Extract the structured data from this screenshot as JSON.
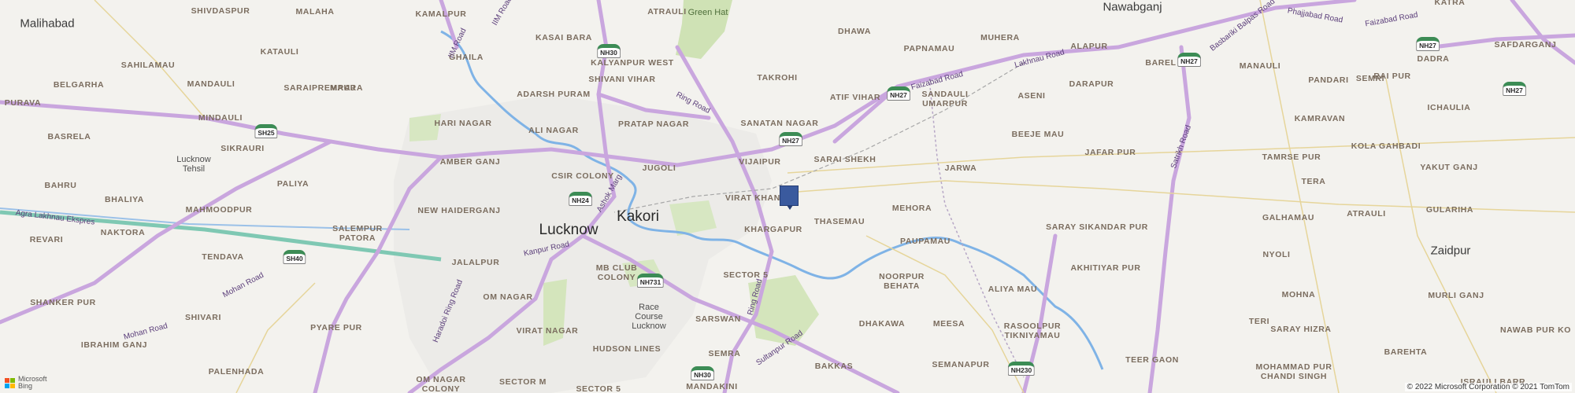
{
  "map": {
    "labels": [
      {
        "id": "malihabad",
        "text": "Malihabad",
        "cls": "city"
      },
      {
        "id": "shivdaspur",
        "text": "SHIVDASPUR",
        "cls": "loc"
      },
      {
        "id": "malaha",
        "text": "MALAHA",
        "cls": "loc"
      },
      {
        "id": "kasai-bara",
        "text": "KASAI BARA",
        "cls": "loc"
      },
      {
        "id": "atrauli-north",
        "text": "ATRAULI",
        "cls": "loc"
      },
      {
        "id": "green-hat",
        "text": "Green Hat",
        "cls": "green"
      },
      {
        "id": "dhawa",
        "text": "DHAWA",
        "cls": "loc"
      },
      {
        "id": "papnamau",
        "text": "PAPNAMAU",
        "cls": "loc"
      },
      {
        "id": "muhera",
        "text": "MUHERA",
        "cls": "loc"
      },
      {
        "id": "nawabganj",
        "text": "Nawabganj",
        "cls": "city"
      },
      {
        "id": "katra",
        "text": "KATRA",
        "cls": "loc"
      },
      {
        "id": "kamalpur",
        "text": "KAMALPUR",
        "cls": "loc"
      },
      {
        "id": "katauli",
        "text": "KATAULI",
        "cls": "loc"
      },
      {
        "id": "ghaila",
        "text": "GHAILA",
        "cls": "loc"
      },
      {
        "id": "kalyanpur-west",
        "text": "KALYANPUR WEST",
        "cls": "loc"
      },
      {
        "id": "alapur",
        "text": "ALAPUR",
        "cls": "loc"
      },
      {
        "id": "barel",
        "text": "BAREL",
        "cls": "loc"
      },
      {
        "id": "safdarganj",
        "text": "SAFDARGANJ",
        "cls": "loc"
      },
      {
        "id": "sahilamau",
        "text": "SAHILAMAU",
        "cls": "loc"
      },
      {
        "id": "mandauli",
        "text": "MANDAULI",
        "cls": "loc"
      },
      {
        "id": "maura",
        "text": "MAURA",
        "cls": "loc"
      },
      {
        "id": "shivani-vihar",
        "text": "SHIVANI VIHAR",
        "cls": "loc"
      },
      {
        "id": "semri",
        "text": "SEMRI",
        "cls": "loc"
      },
      {
        "id": "dadra",
        "text": "DADRA",
        "cls": "loc"
      },
      {
        "id": "belgarha",
        "text": "BELGARHA",
        "cls": "loc"
      },
      {
        "id": "saraipremraj",
        "text": "SARAIPREMRAJ",
        "cls": "loc"
      },
      {
        "id": "takrohi",
        "text": "TAKROHI",
        "cls": "loc"
      },
      {
        "id": "darapur",
        "text": "DARAPUR",
        "cls": "loc"
      },
      {
        "id": "manauli",
        "text": "MANAULI",
        "cls": "loc"
      },
      {
        "id": "pandari",
        "text": "PANDARI",
        "cls": "loc"
      },
      {
        "id": "rai-pur",
        "text": "RAI PUR",
        "cls": "loc"
      },
      {
        "id": "purava",
        "text": "PURAVA",
        "cls": "loc"
      },
      {
        "id": "adarsh-puram",
        "text": "ADARSH PURAM",
        "cls": "loc"
      },
      {
        "id": "atif-vihar",
        "text": "ATIF VIHAR",
        "cls": "loc"
      },
      {
        "id": "sandauli-umarpur",
        "text": "SANDAULI\nUMARPUR",
        "cls": "loc"
      },
      {
        "id": "aseni",
        "text": "ASENI",
        "cls": "loc"
      },
      {
        "id": "kamravan",
        "text": "KAMRAVAN",
        "cls": "loc"
      },
      {
        "id": "ichaulia",
        "text": "ICHAULIA",
        "cls": "loc"
      },
      {
        "id": "mindauli",
        "text": "MINDAULI",
        "cls": "loc"
      },
      {
        "id": "hari-nagar",
        "text": "HARI NAGAR",
        "cls": "loc"
      },
      {
        "id": "pratap-nagar",
        "text": "PRATAP NAGAR",
        "cls": "loc"
      },
      {
        "id": "sanatan-nagar",
        "text": "SANATAN NAGAR",
        "cls": "loc"
      },
      {
        "id": "basrela",
        "text": "BASRELA",
        "cls": "loc"
      },
      {
        "id": "ali-nagar",
        "text": "ALI NAGAR",
        "cls": "loc"
      },
      {
        "id": "beeje-mau",
        "text": "BEEJE MAU",
        "cls": "loc"
      },
      {
        "id": "kola-gahbadi",
        "text": "KOLA GAHBADI",
        "cls": "loc"
      },
      {
        "id": "lucknow-tehsil",
        "text": "Lucknow\nTehsil",
        "cls": "small"
      },
      {
        "id": "sikrauri",
        "text": "SIKRAURI",
        "cls": "loc"
      },
      {
        "id": "amber-ganj",
        "text": "AMBER GANJ",
        "cls": "loc"
      },
      {
        "id": "jugoli",
        "text": "JUGOLI",
        "cls": "loc"
      },
      {
        "id": "vijaipur",
        "text": "VIJAIPUR",
        "cls": "loc"
      },
      {
        "id": "sarai-shekh",
        "text": "SARAI SHEKH",
        "cls": "loc"
      },
      {
        "id": "jafar-pur",
        "text": "JAFAR PUR",
        "cls": "loc"
      },
      {
        "id": "jarwa",
        "text": "JARWA",
        "cls": "loc"
      },
      {
        "id": "tamrse-pur",
        "text": "TAMRSE PUR",
        "cls": "loc"
      },
      {
        "id": "csir-colony",
        "text": "CSIR COLONY",
        "cls": "loc"
      },
      {
        "id": "bahru",
        "text": "BAHRU",
        "cls": "loc"
      },
      {
        "id": "paliya",
        "text": "PALIYA",
        "cls": "loc"
      },
      {
        "id": "tera",
        "text": "TERA",
        "cls": "loc"
      },
      {
        "id": "yakut-ganj",
        "text": "YAKUT GANJ",
        "cls": "loc"
      },
      {
        "id": "kakori",
        "text": "Kakori",
        "cls": "bigcity"
      },
      {
        "id": "virat-khand",
        "text": "VIRAT KHAND",
        "cls": "loc"
      },
      {
        "id": "bhaliya",
        "text": "BHALIYA",
        "cls": "loc"
      },
      {
        "id": "mahmoodpur",
        "text": "MAHMOODPUR",
        "cls": "loc"
      },
      {
        "id": "new-haiderganj",
        "text": "NEW HAIDERGANJ",
        "cls": "loc"
      },
      {
        "id": "mehora",
        "text": "MEHORA",
        "cls": "loc"
      },
      {
        "id": "thasemau",
        "text": "THASEMAU",
        "cls": "loc"
      },
      {
        "id": "atrauli",
        "text": "ATRAULI",
        "cls": "loc"
      },
      {
        "id": "gularia",
        "text": "GULARIHA",
        "cls": "loc"
      },
      {
        "id": "galhamau",
        "text": "GALHAMAU",
        "cls": "loc"
      },
      {
        "id": "naktora",
        "text": "NAKTORA",
        "cls": "loc"
      },
      {
        "id": "salempur-patora",
        "text": "SALEMPUR\nPATORA",
        "cls": "loc"
      },
      {
        "id": "lucknow",
        "text": "Lucknow",
        "cls": "bigcity"
      },
      {
        "id": "khargapur",
        "text": "KHARGAPUR",
        "cls": "loc"
      },
      {
        "id": "saray-sikandar-pur",
        "text": "SARAY SIKANDAR PUR",
        "cls": "loc"
      },
      {
        "id": "revari",
        "text": "REVARI",
        "cls": "loc"
      },
      {
        "id": "paupamau",
        "text": "PAUPAMAU",
        "cls": "loc"
      },
      {
        "id": "zaidpur",
        "text": "Zaidpur",
        "cls": "city"
      },
      {
        "id": "tendava",
        "text": "TENDAVA",
        "cls": "loc"
      },
      {
        "id": "jalalpur",
        "text": "JALALPUR",
        "cls": "loc"
      },
      {
        "id": "mb-club-colony",
        "text": "MB CLUB\nCOLONY",
        "cls": "loc"
      },
      {
        "id": "sector-5",
        "text": "SECTOR 5",
        "cls": "loc"
      },
      {
        "id": "akhitiyar-pur",
        "text": "AKHITIYAR PUR",
        "cls": "loc"
      },
      {
        "id": "nyoli",
        "text": "NYOLI",
        "cls": "loc"
      },
      {
        "id": "noorpur-behata",
        "text": "NOORPUR\nBEHATA",
        "cls": "loc"
      },
      {
        "id": "aliya-mau",
        "text": "ALIYA MAU",
        "cls": "loc"
      },
      {
        "id": "om-nagar",
        "text": "OM NAGAR",
        "cls": "loc"
      },
      {
        "id": "shanker-pur",
        "text": "SHANKER PUR",
        "cls": "loc"
      },
      {
        "id": "mohna",
        "text": "MOHNA",
        "cls": "loc"
      },
      {
        "id": "murli-ganj",
        "text": "MURLI GANJ",
        "cls": "loc"
      },
      {
        "id": "race-course",
        "text": "Race\nCourse\nLucknow",
        "cls": "small"
      },
      {
        "id": "shivari",
        "text": "SHIVARI",
        "cls": "loc"
      },
      {
        "id": "sarswan",
        "text": "SARSWAN",
        "cls": "loc"
      },
      {
        "id": "dhakawa",
        "text": "DHAKAWA",
        "cls": "loc"
      },
      {
        "id": "meesa",
        "text": "MEESA",
        "cls": "loc"
      },
      {
        "id": "rasoolpur",
        "text": "RASOOLPUR\nTIKNIYAMAU",
        "cls": "loc"
      },
      {
        "id": "teri",
        "text": "TERI",
        "cls": "loc"
      },
      {
        "id": "saray-hizra",
        "text": "SARAY HIZRA",
        "cls": "loc"
      },
      {
        "id": "nawab-pur-ko",
        "text": "NAWAB PUR KO",
        "cls": "loc"
      },
      {
        "id": "pyare-pur",
        "text": "PYARE PUR",
        "cls": "loc"
      },
      {
        "id": "virat-nagar",
        "text": "VIRAT NAGAR",
        "cls": "loc"
      },
      {
        "id": "ibrahim-ganj",
        "text": "IBRAHIM GANJ",
        "cls": "loc"
      },
      {
        "id": "hudson-lines",
        "text": "HUDSON LINES",
        "cls": "loc"
      },
      {
        "id": "barehta",
        "text": "BAREHTA",
        "cls": "loc"
      },
      {
        "id": "semra",
        "text": "SEMRA",
        "cls": "loc"
      },
      {
        "id": "bakkas",
        "text": "BAKKAS",
        "cls": "loc"
      },
      {
        "id": "semanapur",
        "text": "SEMANAPUR",
        "cls": "loc"
      },
      {
        "id": "teer-gaon",
        "text": "TEER GAON",
        "cls": "loc"
      },
      {
        "id": "mohammad-pur",
        "text": "MOHAMMAD PUR\nCHANDI SINGH",
        "cls": "loc"
      },
      {
        "id": "palenhada",
        "text": "PALENHADA",
        "cls": "loc"
      },
      {
        "id": "om-nagar-colony",
        "text": "OM NAGAR\nCOLONY",
        "cls": "loc"
      },
      {
        "id": "sector-m",
        "text": "SECTOR M",
        "cls": "loc"
      },
      {
        "id": "sector-5b",
        "text": "SECTOR 5",
        "cls": "loc"
      },
      {
        "id": "mandakini",
        "text": "MANDAKINI",
        "cls": "loc"
      },
      {
        "id": "israuli-barr",
        "text": "ISRAULI BARR",
        "cls": "loc"
      }
    ],
    "roads": [
      {
        "id": "iim-road",
        "text": "IIM Road"
      },
      {
        "id": "iim-road-2",
        "text": "IIM Road"
      },
      {
        "id": "faizabad-road",
        "text": "Faizabad Road"
      },
      {
        "id": "lakhnau-road",
        "text": "Lakhnau Road"
      },
      {
        "id": "basbariki-balpas-road",
        "text": "Basbariki Balpas Road"
      },
      {
        "id": "phajjabad-road",
        "text": "Phajjabad Road"
      },
      {
        "id": "faizabad-road-2",
        "text": "Faizabad Road"
      },
      {
        "id": "ring-road",
        "text": "Ring Road"
      },
      {
        "id": "satrikh-road",
        "text": "Satrikh Road"
      },
      {
        "id": "ashok-marg",
        "text": "Ashok Marg"
      },
      {
        "id": "agra-expressway",
        "text": "Agra Lakhnau Ekspres"
      },
      {
        "id": "kanpur-road",
        "text": "Kanpur Road"
      },
      {
        "id": "haradoi-ring-road",
        "text": "Haradoi Ring Road"
      },
      {
        "id": "mohan-road",
        "text": "Mohan Road"
      },
      {
        "id": "mohan-road-2",
        "text": "Mohan Road"
      },
      {
        "id": "ring-road-2",
        "text": "Ring Road"
      },
      {
        "id": "sultanpur-road",
        "text": "Sultanpur Road"
      }
    ],
    "shields": [
      {
        "id": "nh30-north",
        "text": "NH30"
      },
      {
        "id": "nh27-west",
        "text": "NH27"
      },
      {
        "id": "nh27-barel",
        "text": "NH27"
      },
      {
        "id": "nh27-dadra",
        "text": "NH27"
      },
      {
        "id": "nh27-east",
        "text": "NH27"
      },
      {
        "id": "sh25",
        "text": "SH25"
      },
      {
        "id": "nh27-center",
        "text": "NH27"
      },
      {
        "id": "nh24",
        "text": "NH24"
      },
      {
        "id": "sh40",
        "text": "SH40"
      },
      {
        "id": "nh731",
        "text": "NH731"
      },
      {
        "id": "nh230",
        "text": "NH230"
      },
      {
        "id": "nh30-south",
        "text": "NH30"
      }
    ],
    "marker_icon": "location-pin-icon",
    "logo": {
      "line1": "Microsoft",
      "line2": "Bing",
      "colors": [
        "#f25022",
        "#7fba00",
        "#00a4ef",
        "#ffb900"
      ]
    },
    "copyright": "© 2022 Microsoft Corporation © 2021 TomTom",
    "colors": {
      "background": "#f3f2ee",
      "highway": "#c9a6de",
      "river": "#7fb3e6",
      "park": "#cfe2b5",
      "marker": "#3a5a9e"
    }
  }
}
